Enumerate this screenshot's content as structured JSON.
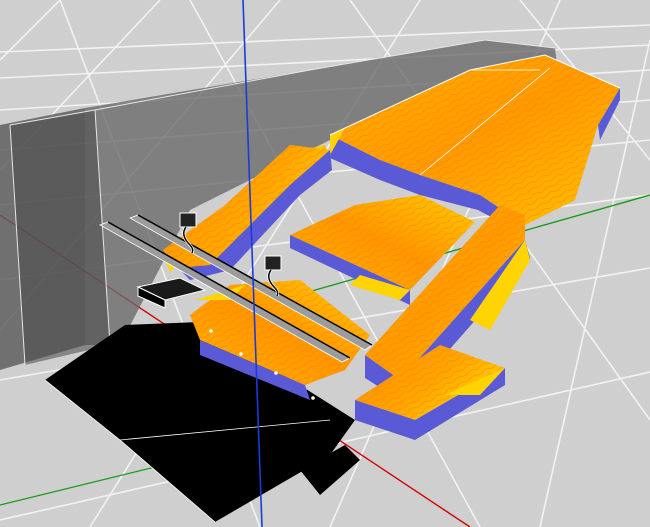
{
  "viewport": {
    "background": "#cfcfcf",
    "grid_color": "#f2f2f2",
    "axis_colors": {
      "x_axis": "#d40000",
      "y_axis": "#169c16",
      "z_axis": "#1b3cd8"
    }
  },
  "scene": {
    "surface_colors": {
      "wood_top": "#ff9a00",
      "wood_highlight": "#ffd200",
      "side_face": "#5a5ad6",
      "wall": "#5a5a5a",
      "shadow": "#000000",
      "edge": "#ffffff",
      "rail": "#9c9c9c"
    },
    "icons": [
      "speaker-icon",
      "speaker-icon"
    ]
  }
}
